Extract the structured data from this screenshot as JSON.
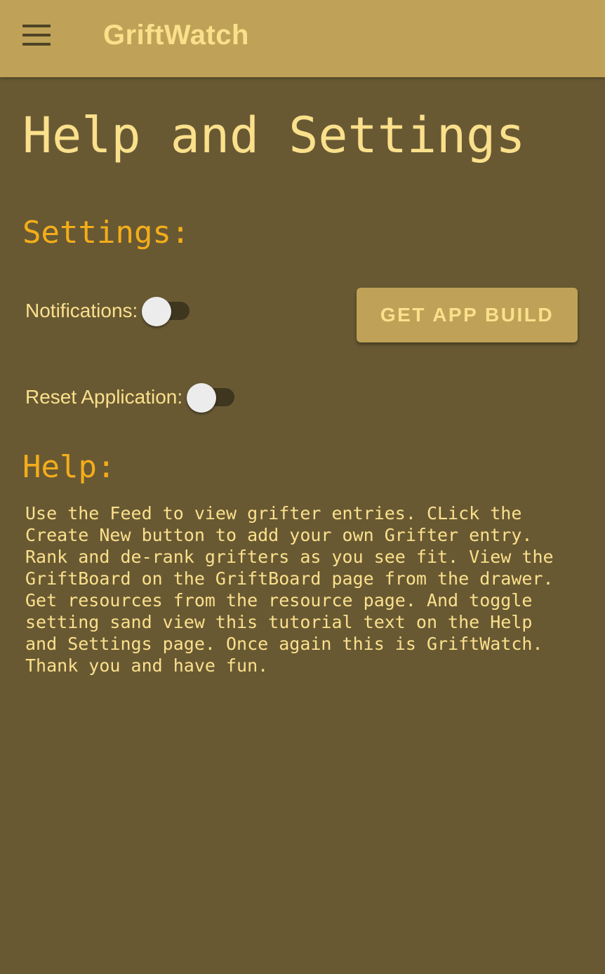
{
  "app_bar": {
    "title": "GriftWatch",
    "menu_icon": "hamburger-menu-icon"
  },
  "page": {
    "title": "Help and Settings"
  },
  "settings": {
    "heading": "Settings:",
    "notifications": {
      "label": "Notifications:",
      "enabled": false
    },
    "reset_application": {
      "label": "Reset Application:",
      "enabled": false
    },
    "get_app_build_button": "GET APP BUILD"
  },
  "help": {
    "heading": "Help:",
    "text": "Use the Feed to view grifter entries. CLick the\nCreate New button to add your own Grifter entry.\nRank and de-rank grifters as you see fit. View the\nGriftBoard on the GriftBoard page from the drawer.\nGet resources from the resource page. And toggle\nsetting sand view this tutorial text on the Help\nand Settings page. Once again this is GriftWatch.\nThank you and have fun."
  },
  "colors": {
    "app_bar": "#bfa257",
    "background": "#685933",
    "text_primary": "#fbe08c",
    "heading_accent": "#f4ad1a",
    "toggle_track": "#3f3620",
    "toggle_thumb": "#ececec"
  }
}
